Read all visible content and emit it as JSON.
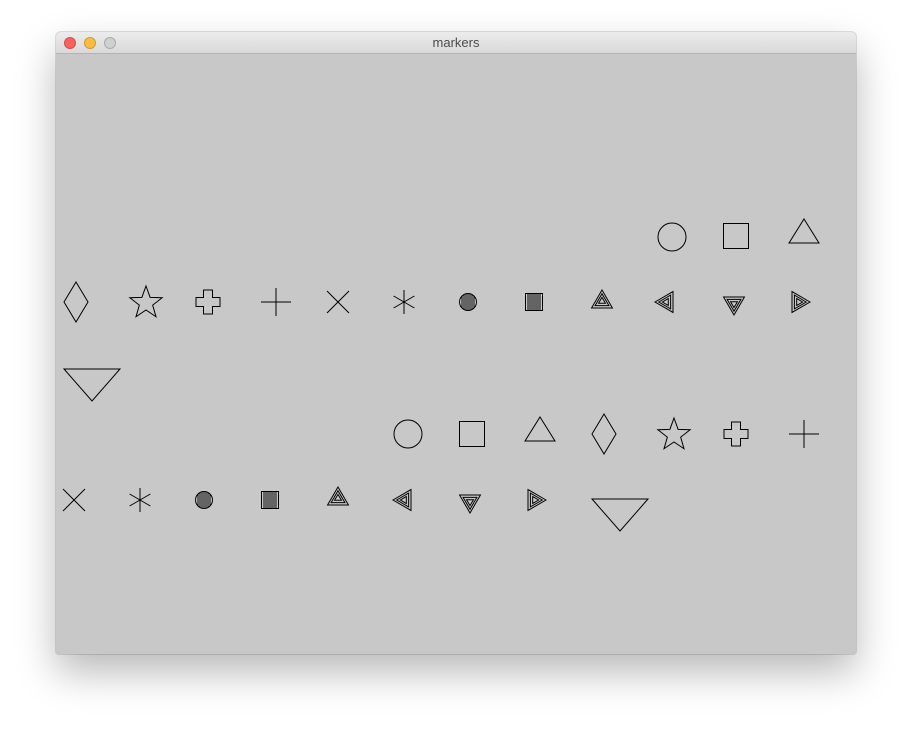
{
  "window": {
    "title": "markers",
    "background": "#c8c8c8",
    "stroke_color": "#000000",
    "traffic_lights": {
      "close_color": "#fc615d",
      "minimize_color": "#fdbc40",
      "zoom_color": "#d0d0d0"
    }
  },
  "markers": {
    "sequence_1": [
      "circle",
      "square",
      "triangle-up",
      "diamond",
      "star",
      "cross",
      "plus",
      "x",
      "asterisk",
      "hatched-circle",
      "hatched-square",
      "concentric-triangle-up",
      "concentric-triangle-left",
      "concentric-triangle-down",
      "concentric-triangle-right",
      "triangle-down"
    ],
    "sequence_2": [
      "circle",
      "square",
      "triangle-up",
      "diamond",
      "star",
      "cross",
      "plus",
      "x",
      "asterisk",
      "hatched-circle",
      "hatched-square",
      "concentric-triangle-up",
      "concentric-triangle-left",
      "concentric-triangle-down",
      "concentric-triangle-right",
      "triangle-down"
    ]
  }
}
